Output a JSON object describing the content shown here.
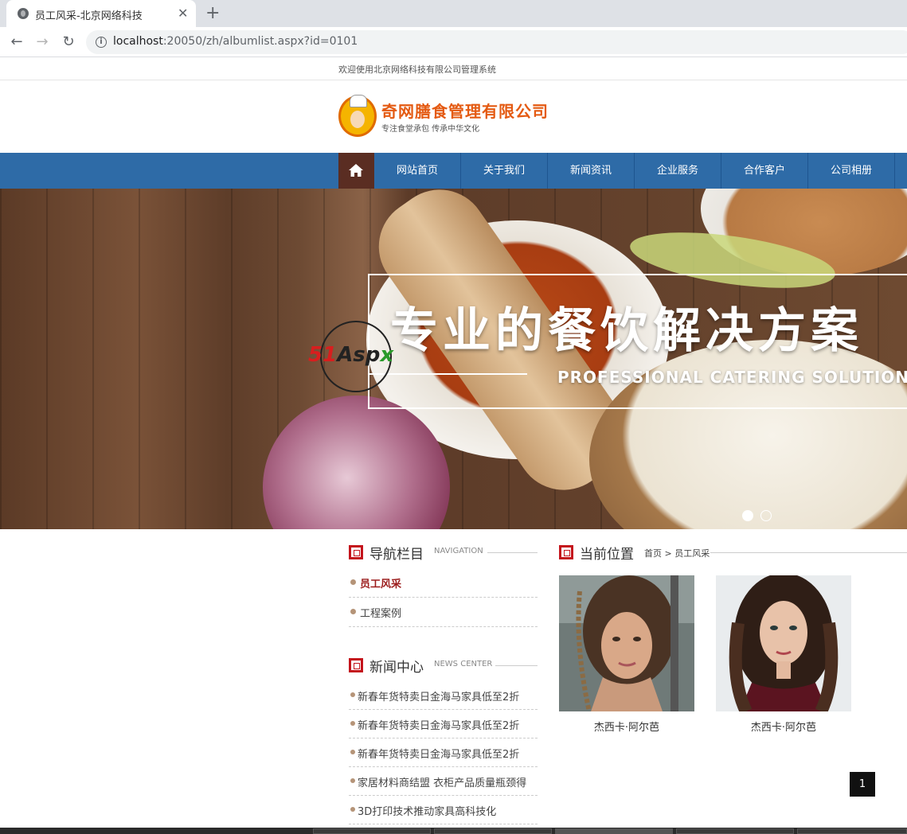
{
  "browser": {
    "tab_title": "员工风采-北京网络科技",
    "tab_close": "✕",
    "new_tab": "+",
    "url_host": "localhost",
    "url_rest": ":20050/zh/albumlist.aspx?id=0101",
    "back": "←",
    "forward": "→",
    "reload": "↻"
  },
  "page": {
    "welcome": "欢迎使用北京网络科技有限公司管理系统",
    "logo_title": "奇网膳食管理有限公司",
    "logo_slogan": "专注食堂承包 传承中华文化"
  },
  "mainnav": {
    "items": [
      "网站首页",
      "关于我们",
      "新闻资讯",
      "企业服务",
      "合作客户",
      "公司相册"
    ]
  },
  "banner": {
    "headline": "专业的餐饮解决方案",
    "sub": "PROFESSIONAL CATERING SOLUTIONS PR",
    "watermark_a": "51",
    "watermark_b": "Asp",
    "watermark_c": "x"
  },
  "sidebar": {
    "nav_title": "导航栏目",
    "nav_title_en": "NAVIGATION",
    "nav_items": [
      "员工风采",
      "工程案例"
    ],
    "news_title": "新闻中心",
    "news_title_en": "NEWS CENTER",
    "news_items": [
      "新春年货特卖日金海马家具低至2折",
      "新春年货特卖日金海马家具低至2折",
      "新春年货特卖日金海马家具低至2折",
      "家居材料商结盟 衣柜产品质量瓶颈得",
      "3D打印技术推动家具高科技化"
    ]
  },
  "content": {
    "location_title": "当前位置",
    "breadcrumb_home": "首页",
    "breadcrumb_sep": ">",
    "breadcrumb_current": "员工风采",
    "photos": [
      {
        "caption": "杰西卡·阿尔芭"
      },
      {
        "caption": "杰西卡·阿尔芭"
      }
    ],
    "pager": "1"
  },
  "colors": {
    "nav_blue": "#2e6ba7",
    "home_brown": "#5a2d22",
    "accent_red": "#c4141c"
  }
}
